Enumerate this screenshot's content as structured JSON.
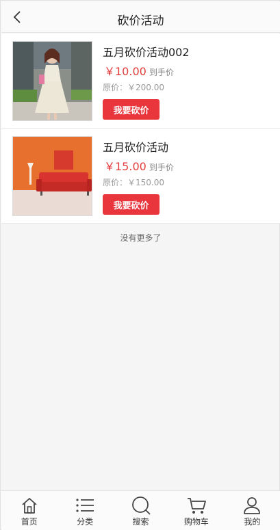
{
  "header": {
    "title": "砍价活动"
  },
  "items": [
    {
      "name": "五月砍价活动002",
      "price": "￥10.00",
      "price_note": "到手价",
      "original": "原价：￥200.00",
      "button": "我要砍价",
      "image": "dress-photo"
    },
    {
      "name": "五月砍价活动",
      "price": "￥15.00",
      "price_note": "到手价",
      "original": "原价：￥150.00",
      "button": "我要砍价",
      "image": "red-sofa-photo"
    }
  ],
  "list_end_text": "没有更多了",
  "tabbar": {
    "home": "首页",
    "category": "分类",
    "search": "搜索",
    "cart": "购物车",
    "mine": "我的"
  },
  "colors": {
    "accent": "#e8363c",
    "price": "#e23a3a"
  }
}
